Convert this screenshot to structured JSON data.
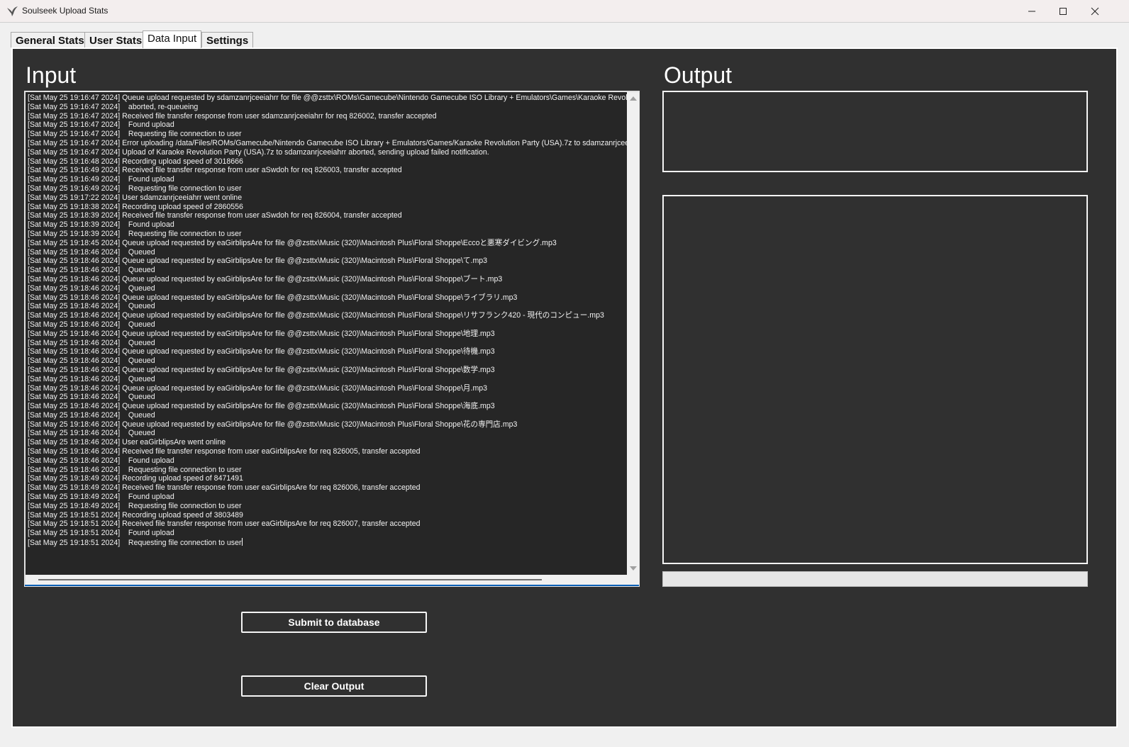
{
  "window": {
    "title": "Soulseek Upload Stats"
  },
  "tabs": [
    {
      "label": "General Stats"
    },
    {
      "label": "User Stats"
    },
    {
      "label": "Data Input",
      "active": true
    },
    {
      "label": "Settings"
    }
  ],
  "input": {
    "heading": "Input",
    "log_text": "[Sat May 25 19:16:47 2024] Queue upload requested by sdamzanrjceeiahrr for file @@zsttx\\ROMs\\Gamecube\\Nintendo Gamecube ISO Library + Emulators\\Games\\Karaoke Revolu\n[Sat May 25 19:16:47 2024]    aborted, re-queueing\n[Sat May 25 19:16:47 2024] Received file transfer response from user sdamzanrjceeiahrr for req 826002, transfer accepted\n[Sat May 25 19:16:47 2024]    Found upload\n[Sat May 25 19:16:47 2024]    Requesting file connection to user\n[Sat May 25 19:16:47 2024] Error uploading /data/Files/ROMs/Gamecube/Nintendo Gamecube ISO Library + Emulators/Games/Karaoke Revolution Party (USA).7z to sdamzanrjcee\n[Sat May 25 19:16:47 2024] Upload of Karaoke Revolution Party (USA).7z to sdamzanrjceeiahrr aborted, sending upload failed notification.\n[Sat May 25 19:16:48 2024] Recording upload speed of 3018666\n[Sat May 25 19:16:49 2024] Received file transfer response from user aSwdoh for req 826003, transfer accepted\n[Sat May 25 19:16:49 2024]    Found upload\n[Sat May 25 19:16:49 2024]    Requesting file connection to user\n[Sat May 25 19:17:22 2024] User sdamzanrjceeiahrr went online\n[Sat May 25 19:18:38 2024] Recording upload speed of 2860556\n[Sat May 25 19:18:39 2024] Received file transfer response from user aSwdoh for req 826004, transfer accepted\n[Sat May 25 19:18:39 2024]    Found upload\n[Sat May 25 19:18:39 2024]    Requesting file connection to user\n[Sat May 25 19:18:45 2024] Queue upload requested by eaGirblipsAre for file @@zsttx\\Music (320)\\Macintosh Plus\\Floral Shoppe\\Eccoと悪寒ダイビング.mp3\n[Sat May 25 19:18:46 2024]    Queued\n[Sat May 25 19:18:46 2024] Queue upload requested by eaGirblipsAre for file @@zsttx\\Music (320)\\Macintosh Plus\\Floral Shoppe\\て.mp3\n[Sat May 25 19:18:46 2024]    Queued\n[Sat May 25 19:18:46 2024] Queue upload requested by eaGirblipsAre for file @@zsttx\\Music (320)\\Macintosh Plus\\Floral Shoppe\\ブート.mp3\n[Sat May 25 19:18:46 2024]    Queued\n[Sat May 25 19:18:46 2024] Queue upload requested by eaGirblipsAre for file @@zsttx\\Music (320)\\Macintosh Plus\\Floral Shoppe\\ライブラリ.mp3\n[Sat May 25 19:18:46 2024]    Queued\n[Sat May 25 19:18:46 2024] Queue upload requested by eaGirblipsAre for file @@zsttx\\Music (320)\\Macintosh Plus\\Floral Shoppe\\リサフランク420 - 現代のコンピュー.mp3\n[Sat May 25 19:18:46 2024]    Queued\n[Sat May 25 19:18:46 2024] Queue upload requested by eaGirblipsAre for file @@zsttx\\Music (320)\\Macintosh Plus\\Floral Shoppe\\地理.mp3\n[Sat May 25 19:18:46 2024]    Queued\n[Sat May 25 19:18:46 2024] Queue upload requested by eaGirblipsAre for file @@zsttx\\Music (320)\\Macintosh Plus\\Floral Shoppe\\待機.mp3\n[Sat May 25 19:18:46 2024]    Queued\n[Sat May 25 19:18:46 2024] Queue upload requested by eaGirblipsAre for file @@zsttx\\Music (320)\\Macintosh Plus\\Floral Shoppe\\数学.mp3\n[Sat May 25 19:18:46 2024]    Queued\n[Sat May 25 19:18:46 2024] Queue upload requested by eaGirblipsAre for file @@zsttx\\Music (320)\\Macintosh Plus\\Floral Shoppe\\月.mp3\n[Sat May 25 19:18:46 2024]    Queued\n[Sat May 25 19:18:46 2024] Queue upload requested by eaGirblipsAre for file @@zsttx\\Music (320)\\Macintosh Plus\\Floral Shoppe\\海底.mp3\n[Sat May 25 19:18:46 2024]    Queued\n[Sat May 25 19:18:46 2024] Queue upload requested by eaGirblipsAre for file @@zsttx\\Music (320)\\Macintosh Plus\\Floral Shoppe\\花の専門店.mp3\n[Sat May 25 19:18:46 2024]    Queued\n[Sat May 25 19:18:46 2024] User eaGirblipsAre went online\n[Sat May 25 19:18:46 2024] Received file transfer response from user eaGirblipsAre for req 826005, transfer accepted\n[Sat May 25 19:18:46 2024]    Found upload\n[Sat May 25 19:18:46 2024]    Requesting file connection to user\n[Sat May 25 19:18:49 2024] Recording upload speed of 8471491\n[Sat May 25 19:18:49 2024] Received file transfer response from user eaGirblipsAre for req 826006, transfer accepted\n[Sat May 25 19:18:49 2024]    Found upload\n[Sat May 25 19:18:49 2024]    Requesting file connection to user\n[Sat May 25 19:18:51 2024] Recording upload speed of 3803489\n[Sat May 25 19:18:51 2024] Received file transfer response from user eaGirblipsAre for req 826007, transfer accepted\n[Sat May 25 19:18:51 2024]    Found upload\n[Sat May 25 19:18:51 2024]    Requesting file connection to user"
  },
  "output": {
    "heading": "Output"
  },
  "buttons": {
    "submit_label": "Submit to database",
    "clear_label": "Clear Output"
  },
  "colors": {
    "background": "#303030",
    "border": "#f5f5f5",
    "focus_accent": "#0a5fb4"
  }
}
